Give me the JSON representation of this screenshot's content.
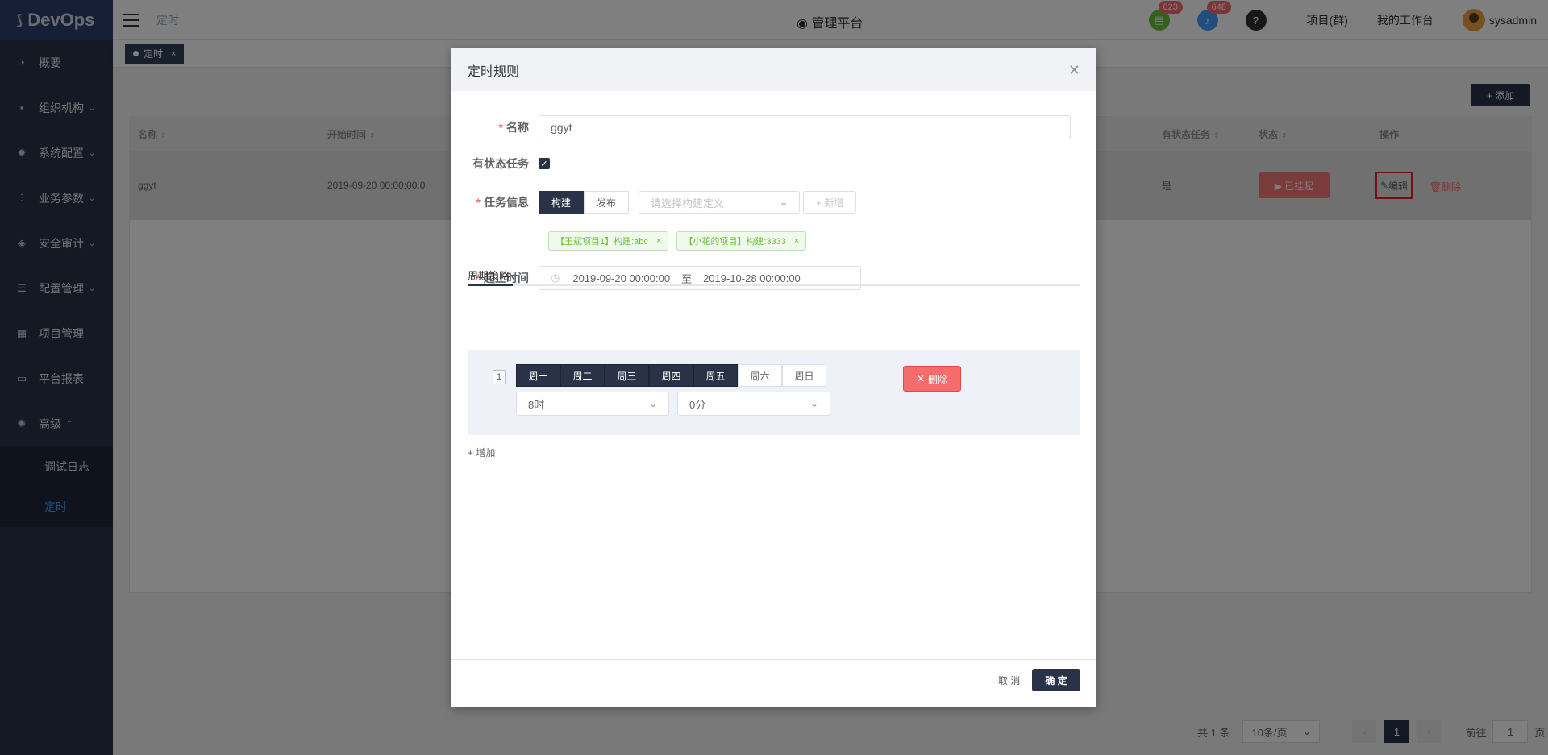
{
  "app": {
    "logo": "DevOps",
    "crumb": "定时",
    "center_title": "管理平台"
  },
  "header": {
    "badge1": "623",
    "badge2": "648",
    "links": [
      "项目(群)",
      "我的工作台"
    ],
    "user": "sysadmin"
  },
  "sidebar": {
    "items": [
      {
        "label": "概要",
        "icon": "dashboard-icon"
      },
      {
        "label": "组织机构",
        "icon": "lock-icon"
      },
      {
        "label": "系统配置",
        "icon": "gear-icon"
      },
      {
        "label": "业务参数",
        "icon": "sliders-icon"
      },
      {
        "label": "安全审计",
        "icon": "shield-icon"
      },
      {
        "label": "配置管理",
        "icon": "database-icon"
      },
      {
        "label": "项目管理",
        "icon": "grid-icon"
      },
      {
        "label": "平台报表",
        "icon": "monitor-icon"
      },
      {
        "label": "高级",
        "icon": "advanced-icon"
      }
    ],
    "sub_items": [
      {
        "label": "调试日志",
        "active": false
      },
      {
        "label": "定时",
        "active": true
      }
    ]
  },
  "tags": {
    "current": "定时"
  },
  "toolbar": {
    "add_label": "+ 添加"
  },
  "table": {
    "headers": [
      "名称",
      "开始时间",
      "有状态任务",
      "状态",
      "操作"
    ],
    "row": {
      "name": "ggyt",
      "start": "2019-09-20 00:00:00.0",
      "stateful": "是",
      "status_btn": "▶ 已挂起",
      "edit": "编辑",
      "delete": "删除"
    }
  },
  "pager": {
    "total": "共 1 条",
    "size": "10条/页",
    "page": "1",
    "goto_prefix": "前往",
    "goto_value": "1",
    "goto_suffix": "页"
  },
  "dialog": {
    "title": "定时规则",
    "name_label": "名称",
    "name_value": "ggyt",
    "stateful_label": "有状态任务",
    "task_label": "任务信息",
    "task_type": [
      "构建",
      "发布"
    ],
    "build_placeholder": "请选择构建定义",
    "new_btn": "+ 新增",
    "task_tags": [
      "【王斌项目1】构建:abc",
      "【小花的项目】构建:3333"
    ],
    "time_label": "起止时间",
    "start_time": "2019-09-20 00:00:00",
    "to": "至",
    "end_time": "2019-10-28 00:00:00",
    "tab": "周期策略",
    "rule": {
      "index": "1",
      "days": [
        {
          "label": "周一",
          "on": true
        },
        {
          "label": "周二",
          "on": true
        },
        {
          "label": "周三",
          "on": true
        },
        {
          "label": "周四",
          "on": true
        },
        {
          "label": "周五",
          "on": true
        },
        {
          "label": "周六",
          "on": false
        },
        {
          "label": "周日",
          "on": false
        }
      ],
      "hour": "8时",
      "minute": "0分",
      "delete": "删除"
    },
    "add_rule": "增加",
    "cancel": "取 消",
    "confirm": "确 定"
  }
}
